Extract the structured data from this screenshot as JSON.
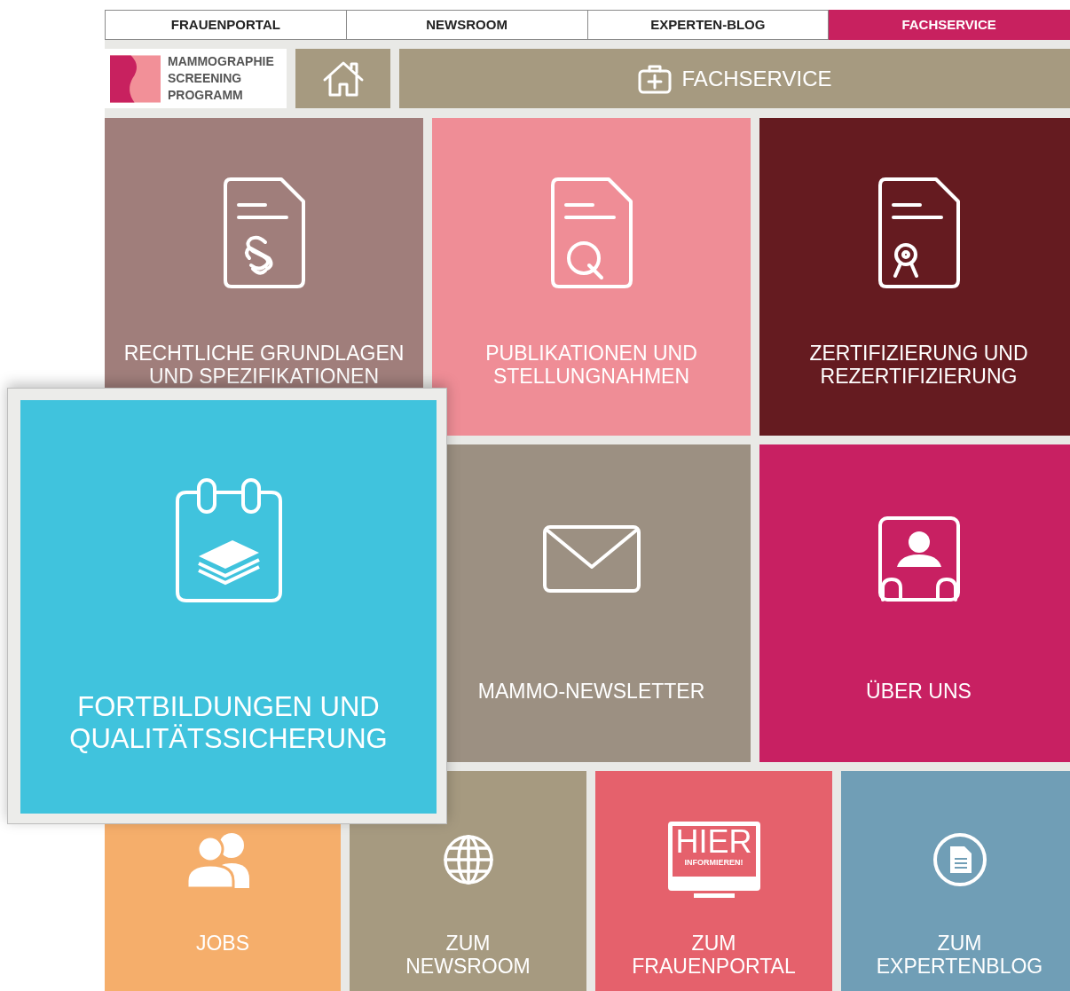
{
  "top_tabs": [
    {
      "label": "FRAUENPORTAL",
      "selected": false
    },
    {
      "label": "NEWSROOM",
      "selected": false
    },
    {
      "label": "EXPERTEN-BLOG",
      "selected": false
    },
    {
      "label": "FACHSERVICE",
      "selected": true
    }
  ],
  "logo": {
    "lines": [
      "MAMMOGRAPHIE",
      "SCREENING",
      "PROGRAMM"
    ]
  },
  "section_bar": {
    "label": "FACHSERVICE"
  },
  "tiles": [
    {
      "label": "RECHTLICHE GRUNDLAGEN\nUND SPEZIFIKATIONEN",
      "kind": "doc-paragraph",
      "color": "#a07e7b"
    },
    {
      "label": "PUBLIKATIONEN UND\nSTELLUNGNAHMEN",
      "kind": "doc-q",
      "color": "#ef8d96"
    },
    {
      "label": "ZERTIFIZIERUNG UND\nREZERTIFIZIERUNG",
      "kind": "doc-award",
      "color": "#651b20"
    },
    {
      "label": "MAMMO-NEWSLETTER",
      "kind": "envelope",
      "color": "#9c9082"
    },
    {
      "label": "ÜBER UNS",
      "kind": "person-card",
      "color": "#c82062"
    }
  ],
  "featured_tile": {
    "label": "FORTBILDUNGEN UND\nQUALITÄTSSICHERUNG",
    "kind": "calendar-books",
    "color": "#40c3dd"
  },
  "bottom_tiles": [
    {
      "label": "JOBS",
      "kind": "users",
      "color": "#f5ae6b"
    },
    {
      "label": "ZUM\nNEWSROOM",
      "kind": "globe",
      "color": "#a69a80"
    },
    {
      "label": "ZUM\nFRAUENPORTAL",
      "kind": "monitor",
      "color": "#e5616c",
      "screen_text": [
        "HIER",
        "INFORMIEREN!"
      ]
    },
    {
      "label": "ZUM\nEXPERTENBLOG",
      "kind": "doc-circle",
      "color": "#709eb6"
    }
  ]
}
